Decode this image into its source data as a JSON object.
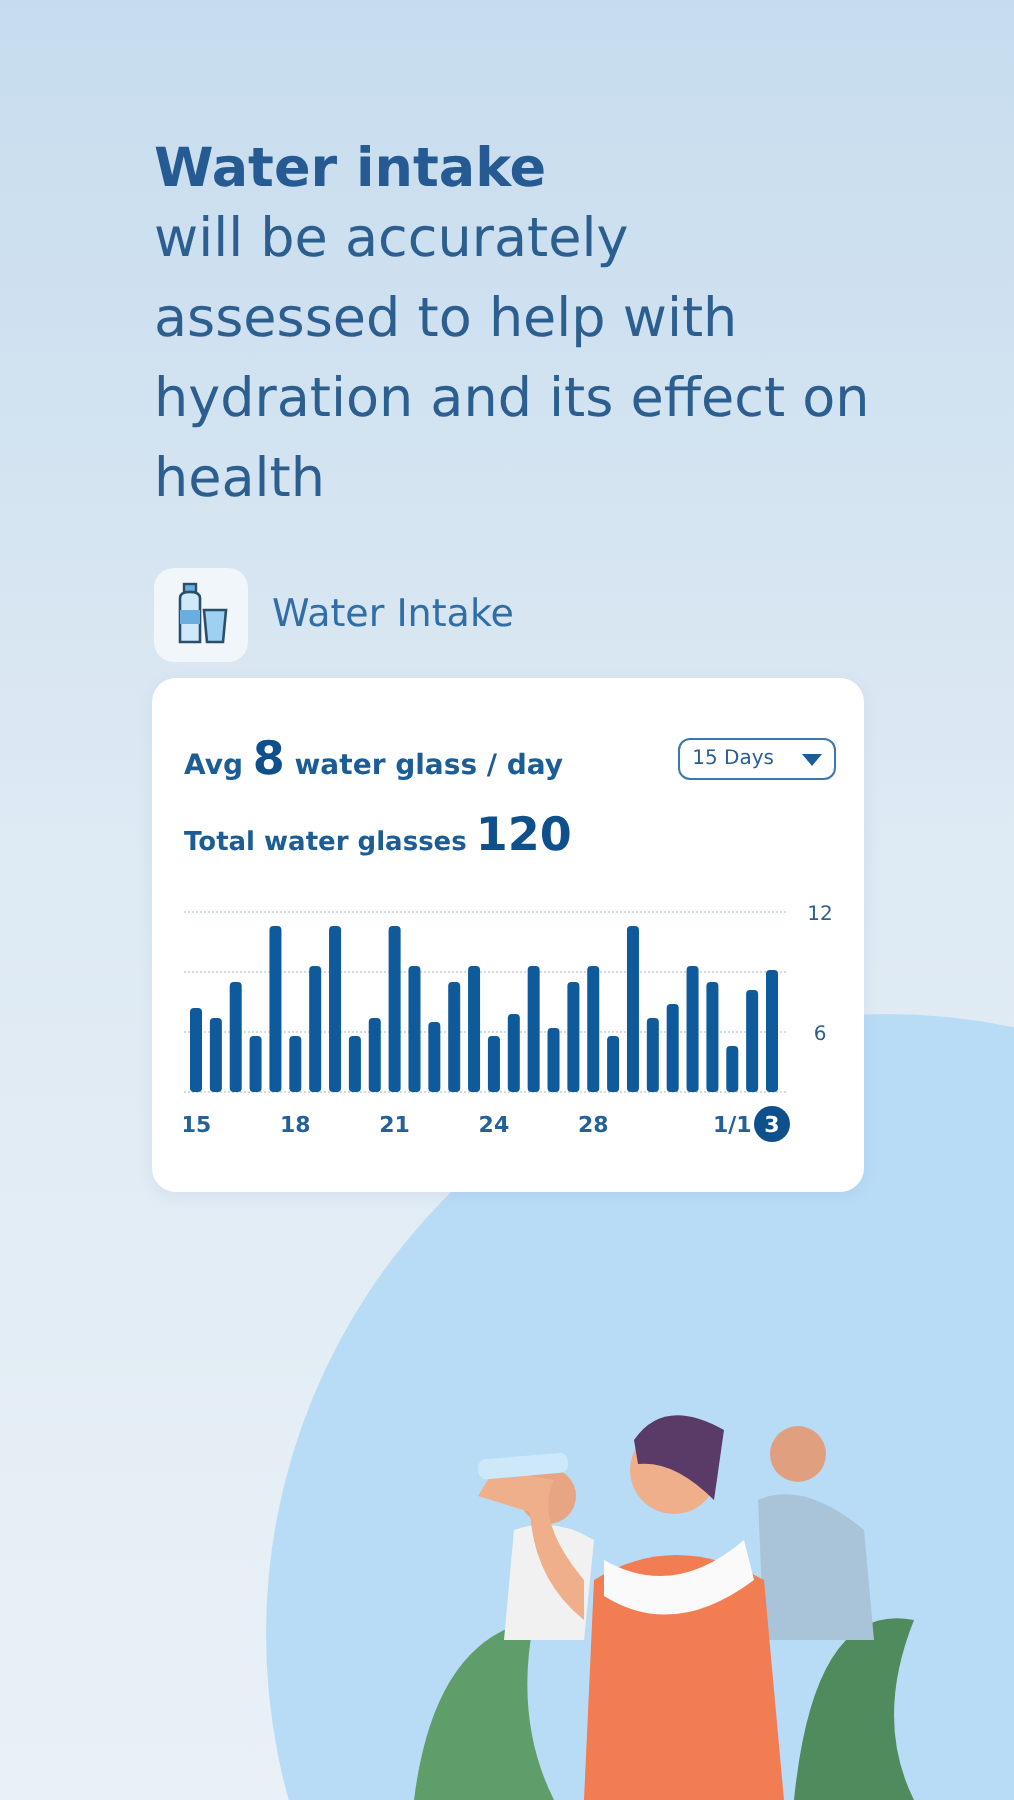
{
  "headline": {
    "title": "Water intake",
    "body": "will be accurately assessed to help with hydration and its effect on health"
  },
  "feature": {
    "label": "Water Intake"
  },
  "card": {
    "avg_prefix": "Avg",
    "avg_value": "8",
    "avg_suffix": "water glass / day",
    "range": "15 Days",
    "total_label": "Total water glasses",
    "total_value": "120",
    "current_day": "3",
    "chart_data": {
      "type": "bar",
      "categories": [
        "15",
        null,
        null,
        null,
        null,
        "18",
        null,
        null,
        null,
        null,
        "21",
        null,
        null,
        null,
        null,
        "24",
        null,
        null,
        null,
        null,
        "28",
        null,
        null,
        null,
        null,
        null,
        null,
        "1/1",
        null,
        null
      ],
      "series": [
        {
          "color": "#0e5a9a",
          "values": [
            7.2,
            6.7,
            8.5,
            5.8,
            11.3,
            5.8,
            9.3,
            11.3,
            5.8,
            6.7,
            11.3,
            9.3,
            6.5,
            8.5,
            9.3,
            5.8,
            6.9,
            9.3,
            6.2,
            8.5,
            9.3,
            5.8,
            11.3,
            6.7,
            7.4,
            9.3,
            8.5,
            5.3,
            8.1,
            9.1
          ]
        }
      ],
      "ylim": [
        3,
        12
      ],
      "yticks": [
        6,
        12
      ]
    }
  }
}
